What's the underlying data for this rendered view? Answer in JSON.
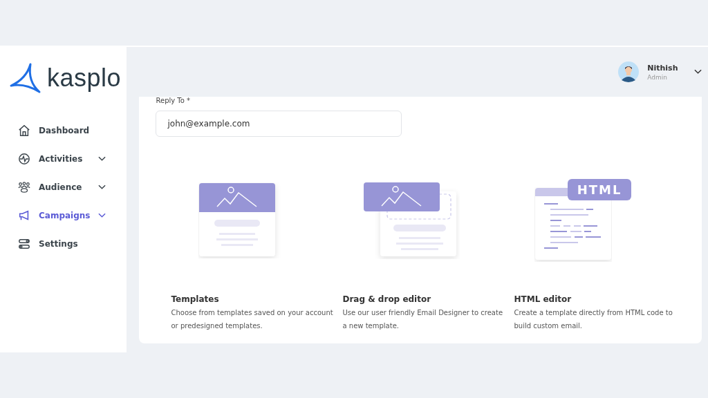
{
  "sidebar": {
    "logo": "kasplo",
    "items": [
      {
        "label": "Dashboard",
        "selected": false,
        "expandable": false
      },
      {
        "label": "Activities",
        "selected": false,
        "expandable": true
      },
      {
        "label": "Audience",
        "selected": false,
        "expandable": true
      },
      {
        "label": "Campaigns",
        "selected": true,
        "expandable": true
      },
      {
        "label": "Settings",
        "selected": false,
        "expandable": false
      }
    ]
  },
  "header": {
    "user": {
      "name": "Nithish",
      "role": "Admin"
    }
  },
  "form": {
    "reply_to": {
      "label": "Reply To *",
      "value": "john@example.com"
    }
  },
  "options": [
    {
      "kind": "image",
      "title": "Templates",
      "description": "Choose from templates saved on your account or predesigned templates."
    },
    {
      "kind": "dragdrop",
      "title": "Drag & drop editor",
      "description": "Use our user friendly Email Designer to create a new template."
    },
    {
      "kind": "html",
      "badge": "HTML",
      "title": "HTML editor",
      "description": "Create a template directly from HTML code to build custom email."
    }
  ]
}
